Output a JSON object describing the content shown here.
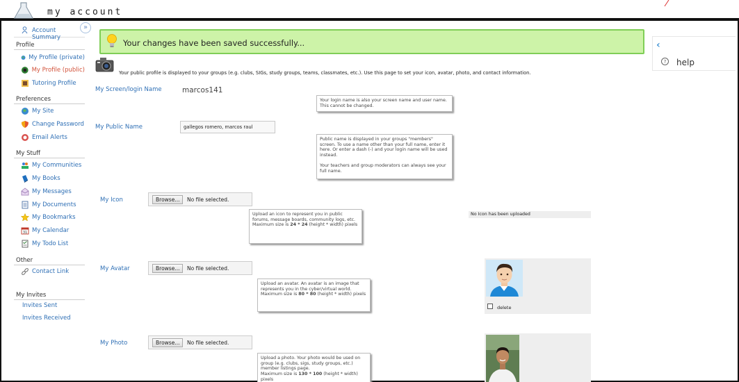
{
  "app": {
    "title": "my account"
  },
  "sidebar": {
    "account_summary": "Account Summary",
    "collapse_glyph": "»",
    "sections": {
      "profile": "Profile",
      "preferences": "Preferences",
      "mystuff": "My Stuff",
      "other": "Other",
      "invites": "My Invites"
    },
    "profile_items": [
      {
        "label": "My Profile (private)",
        "icon": "globe-icon"
      },
      {
        "label": "My Profile (public)",
        "icon": "public-profile-icon",
        "active": true
      },
      {
        "label": "Tutoring Profile",
        "icon": "tutoring-icon"
      }
    ],
    "preferences_items": [
      {
        "label": "My Site",
        "icon": "globe-icon"
      },
      {
        "label": "Change Password",
        "icon": "shield-icon"
      },
      {
        "label": "Email Alerts",
        "icon": "alert-icon"
      }
    ],
    "mystuff_items": [
      {
        "label": "My Communities",
        "icon": "communities-icon"
      },
      {
        "label": "My Books",
        "icon": "books-icon"
      },
      {
        "label": "My Messages",
        "icon": "messages-icon"
      },
      {
        "label": "My Documents",
        "icon": "documents-icon"
      },
      {
        "label": "My Bookmarks",
        "icon": "bookmark-star-icon"
      },
      {
        "label": "My Calendar",
        "icon": "calendar-icon"
      },
      {
        "label": "My Todo List",
        "icon": "todo-icon"
      }
    ],
    "other_items": [
      {
        "label": "Contact Link",
        "icon": "link-icon"
      }
    ],
    "invites_items": [
      {
        "label": "Invites Sent"
      },
      {
        "label": "Invites Received"
      }
    ]
  },
  "banner": {
    "message": "Your changes have been saved successfully..."
  },
  "help": {
    "label": "help",
    "chevron": "‹",
    "q": "?"
  },
  "main": {
    "intro": "Your public profile is displayed to your groups (e.g. clubs, SIGs, study groups, teams, classmates, etc.). Use this page to set your icon, avatar, photo, and contact information.",
    "login": {
      "label": "My Screen/login Name",
      "value": "marcos141",
      "tip": "Your login name is also your screen name and user name. This cannot be changed."
    },
    "public_name": {
      "label": "My Public Name",
      "value": "gallegos romero, marcos raul",
      "tip1": "Public name is displayed in your groups \"members\" screen. To use a name other than your full name, enter it here. Or enter a dash (-) and your login name will be used instead.",
      "tip2": "Your teachers and group moderators can always see your full name."
    },
    "icon": {
      "label": "My Icon",
      "browse": "Browse...",
      "no_file": "No file selected.",
      "tip": "Upload an icon to represent you in public forums, message boards, community logs, etc.",
      "tip_size_prefix": "Maximum size is",
      "tip_size": "24 * 24",
      "tip_size_suffix": "(height * width) pixels",
      "status": "No Icon has been uploaded"
    },
    "avatar": {
      "label": "My Avatar",
      "browse": "Browse...",
      "no_file": "No file selected.",
      "tip": "Upload an avatar. An avatar is an image that represents you in the cyber/virtual world.",
      "tip_size_prefix": "Maximum size is",
      "tip_size": "80 * 80",
      "tip_size_suffix": "(height * width) pixels",
      "delete_label": "delete",
      "delete_checked": false
    },
    "photo": {
      "label": "My Photo",
      "browse": "Browse...",
      "no_file": "No file selected.",
      "tip": "Upload a photo. Your photo would be used on group (e.g. clubs, sigs, study groups, etc.) member listings page.",
      "tip_size_prefix": "Maximum size is",
      "tip_size": "130 * 100",
      "tip_size_suffix": "(height * width) pixels"
    }
  },
  "colors": {
    "link": "#2e6fb5",
    "active": "#d2523a",
    "banner_bg": "#cdf3a8",
    "banner_border": "#7fce56",
    "help_accent": "#4a98d6"
  }
}
